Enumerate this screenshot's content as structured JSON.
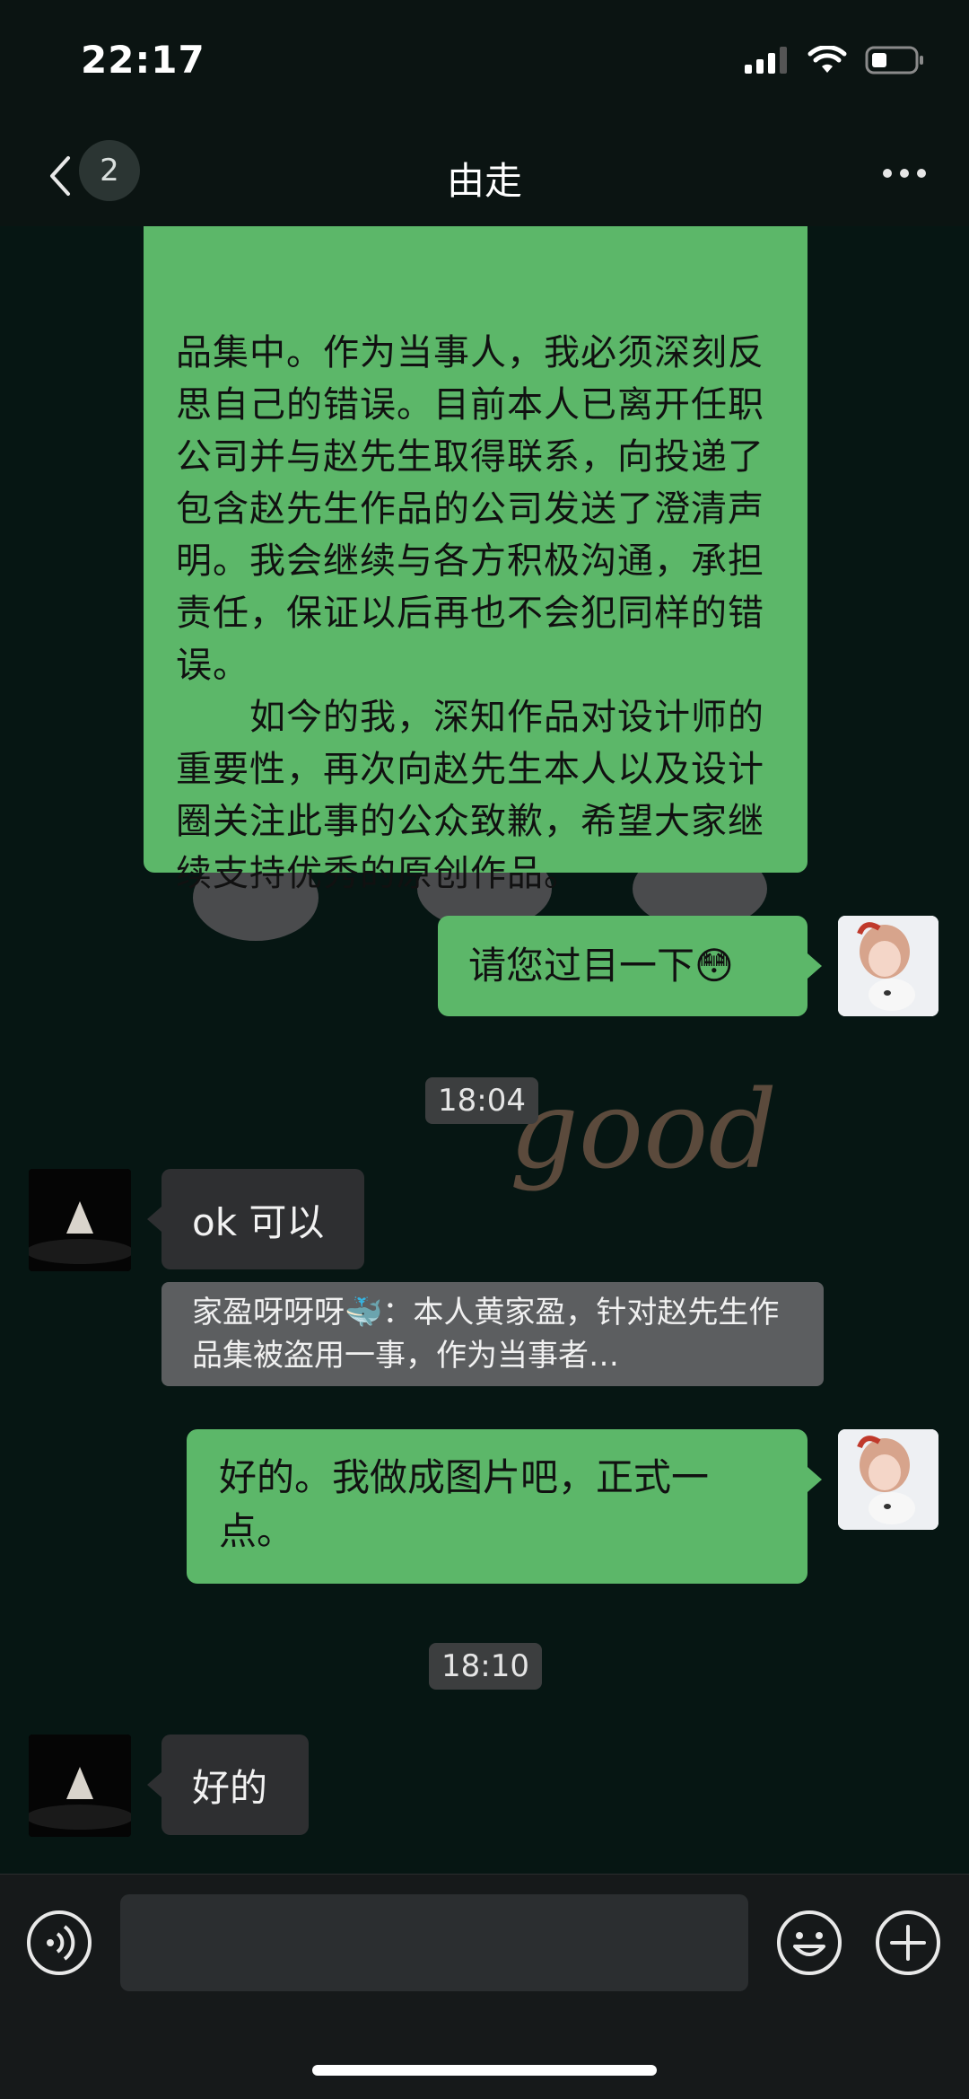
{
  "status_bar": {
    "time": "22:17"
  },
  "header": {
    "unread_count": "2",
    "title": "由走"
  },
  "messages": {
    "long_text": "品集中。作为当事人，我必须深刻反思自己的错误。目前本人已离开任职公司并与赵先生取得联系，向投递了包含赵先生作品的公司发送了澄清声明。我会继续与各方积极沟通，承担责任，保证以后再也不会犯同样的错误。\n　　如今的我，深知作品对设计师的重要性，再次向赵先生本人以及设计圈关注此事的公众致歉，希望大家继续支持优秀的原创作品。",
    "review": "请您过目一下😳",
    "time1": "18:04",
    "ok": "ok 可以",
    "quote": "家盈呀呀呀🐳：本人黄家盈，针对赵先生作品集被盗用一事，作为当事者…",
    "image_reply": "好的。我做成图片吧，正式一点。",
    "time2": "18:10",
    "final": "好的"
  },
  "wallpaper": {
    "doodle_text": "good"
  },
  "colors": {
    "sent_bubble": "#5cb769",
    "received_bubble": "#2e2f31",
    "background": "#061613"
  }
}
